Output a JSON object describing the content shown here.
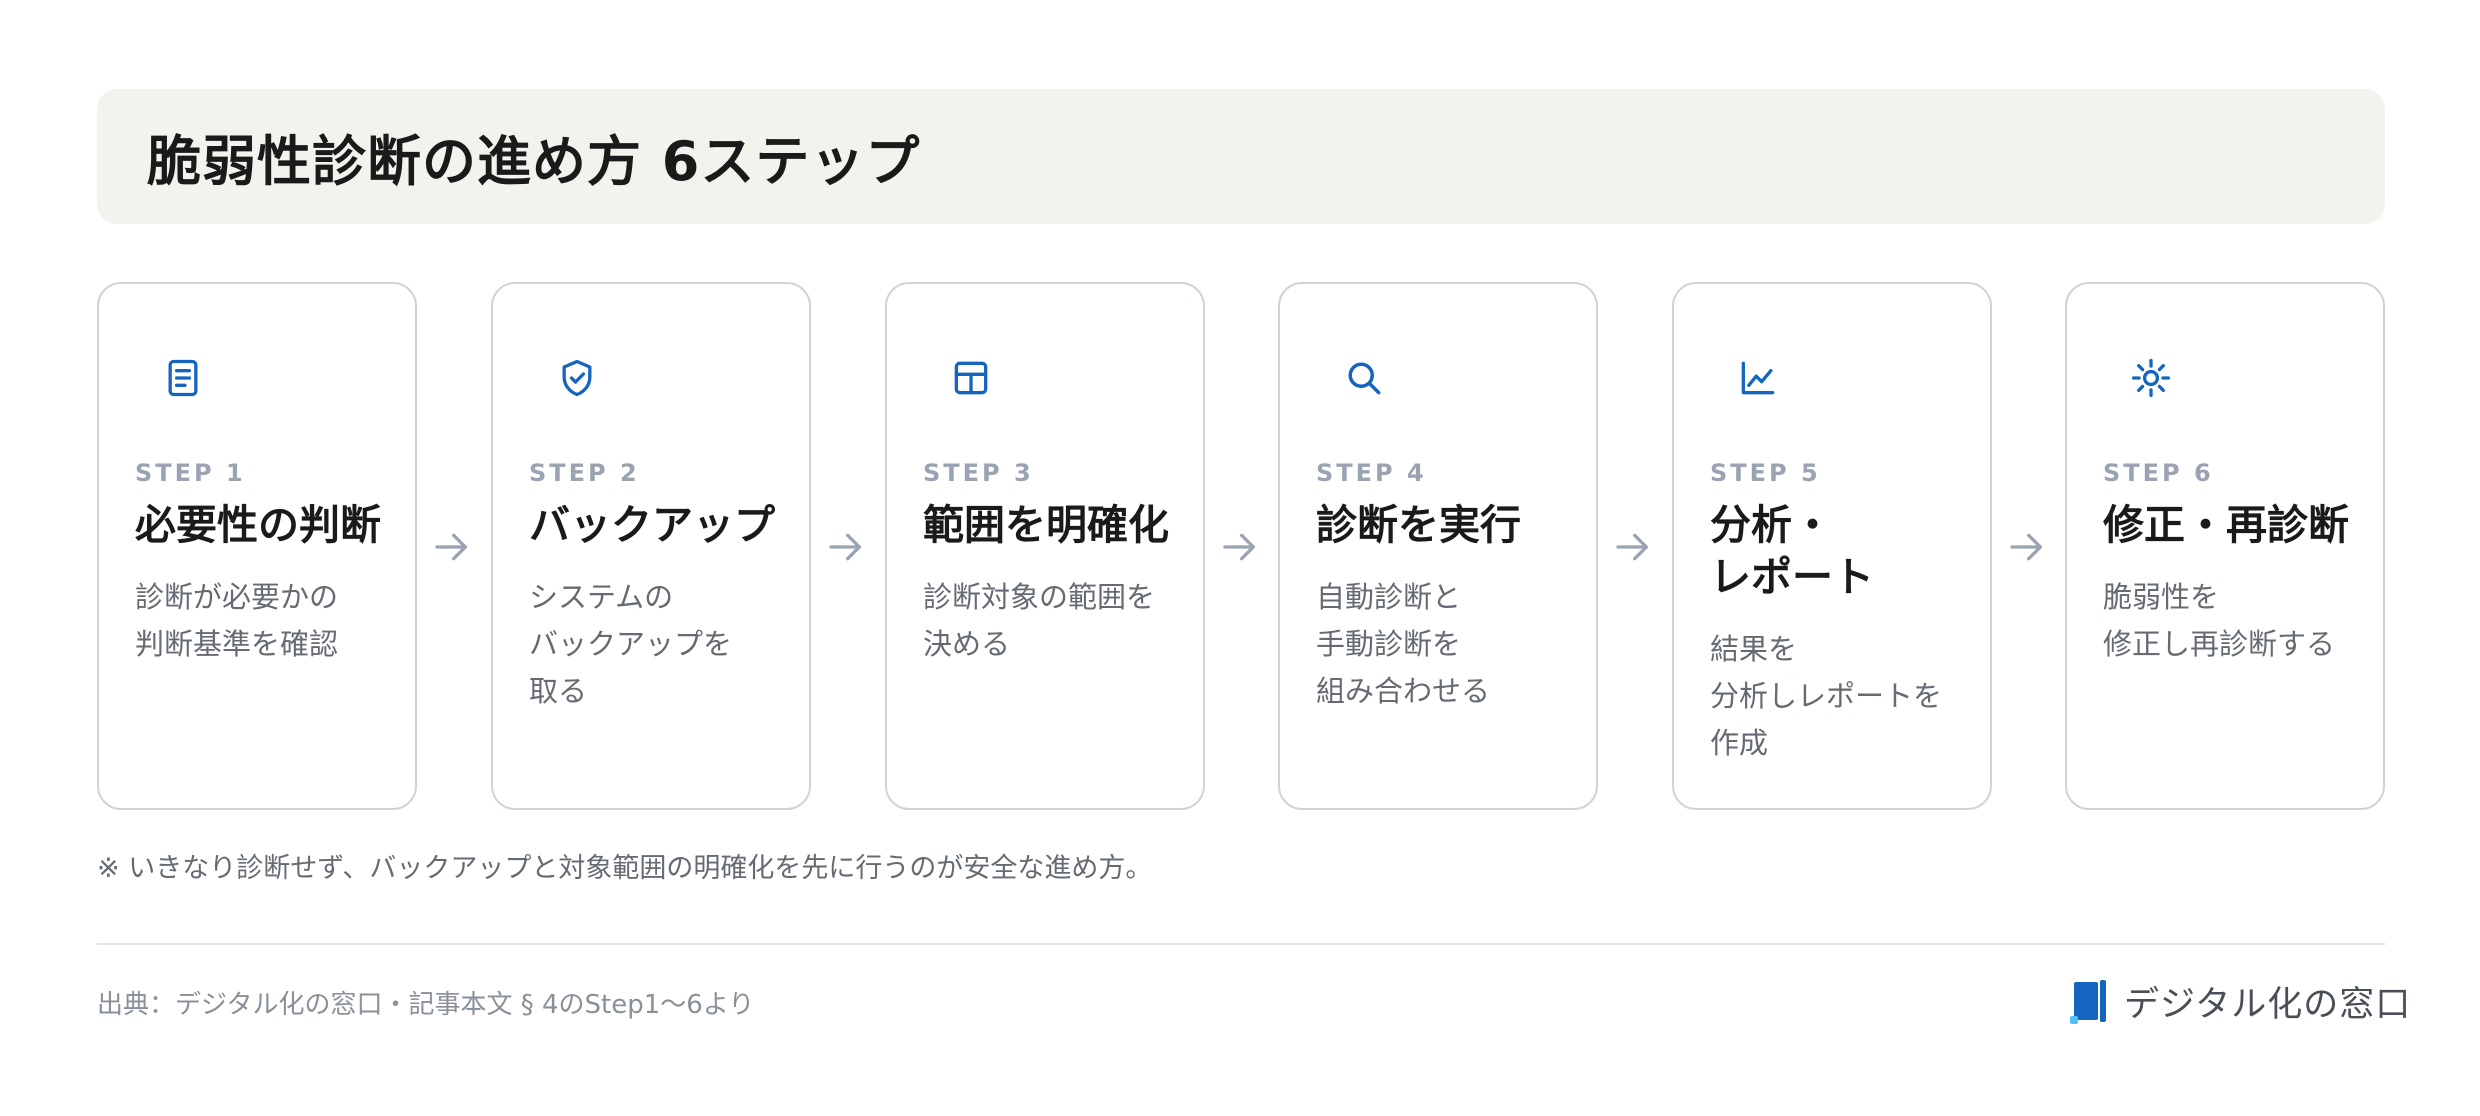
{
  "title": "脆弱性診断の進め方 6ステップ",
  "steps": [
    {
      "step": "STEP 1",
      "title": "必要性の判断",
      "desc": "診断が必要かの\n判断基準を確認",
      "icon": "document-icon"
    },
    {
      "step": "STEP 2",
      "title": "バックアップ",
      "desc": "システムの\nバックアップを\n取る",
      "icon": "shield-check-icon"
    },
    {
      "step": "STEP 3",
      "title": "範囲を明確化",
      "desc": "診断対象の範囲を\n決める",
      "icon": "layout-table-icon"
    },
    {
      "step": "STEP 4",
      "title": "診断を実行",
      "desc": "自動診断と\n手動診断を\n組み合わせる",
      "icon": "search-icon"
    },
    {
      "step": "STEP 5",
      "title": "分析・\nレポート",
      "desc": "結果を\n分析しレポートを\n作成",
      "icon": "line-chart-icon"
    },
    {
      "step": "STEP 6",
      "title": "修正・再診断",
      "desc": "脆弱性を\n修正し再診断する",
      "icon": "sun-gear-icon"
    }
  ],
  "note": "※ いきなり診断せず、バックアップと対象範囲の明確化を先に行うのが安全な進め方。",
  "source": "出典：デジタル化の窓口・記事本文 § 4のStep1〜6より",
  "logo": {
    "text": "デジタル化の窓口",
    "icon": "book-logo-icon"
  },
  "colors": {
    "accent": "#1565c0",
    "title_bg": "#f4f2ed",
    "card_border": "#d0d3d8",
    "step_label": "#9aa3b1",
    "arrow": "#9aa3b1",
    "muted_text": "#666b73"
  }
}
